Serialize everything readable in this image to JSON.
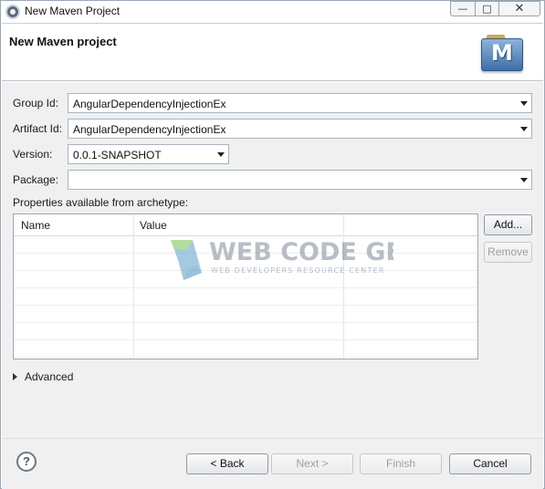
{
  "window": {
    "title": "New Maven Project",
    "controls": {
      "minimize": "—",
      "maximize": "□",
      "close": "✕"
    }
  },
  "header": {
    "title": "New Maven project",
    "logo_letter": "M"
  },
  "form": {
    "group_id": {
      "label": "Group Id:",
      "value": "AngularDependencyInjectionEx"
    },
    "artifact_id": {
      "label": "Artifact Id:",
      "value": "AngularDependencyInjectionEx"
    },
    "version": {
      "label": "Version:",
      "value": "0.0.1-SNAPSHOT"
    },
    "package": {
      "label": "Package:",
      "value": ""
    }
  },
  "properties": {
    "label": "Properties available from archetype:",
    "columns": [
      "Name",
      "Value"
    ],
    "rows": [],
    "add_label": "Add...",
    "remove_label": "Remove"
  },
  "watermark": {
    "line1": "WEB CODE GEEKS",
    "line2": "WEB DEVELOPERS RESOURCE CENTER"
  },
  "advanced": {
    "label": "Advanced"
  },
  "footer": {
    "help": "?",
    "back": "< Back",
    "next": "Next >",
    "finish": "Finish",
    "cancel": "Cancel"
  }
}
